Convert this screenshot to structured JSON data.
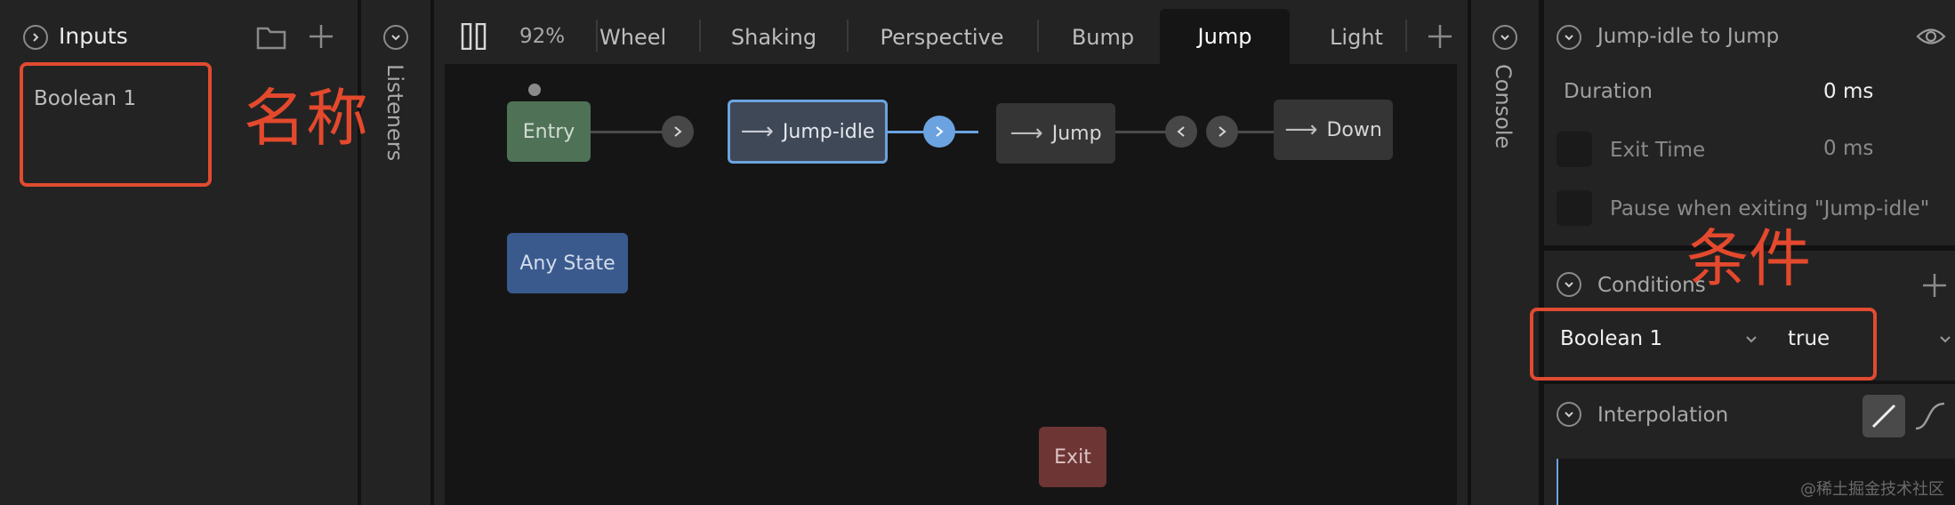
{
  "inputs_panel": {
    "title": "Inputs",
    "items": [
      {
        "label": "Boolean 1"
      }
    ]
  },
  "listeners_panel": {
    "title": "Listeners"
  },
  "console_panel": {
    "title": "Console"
  },
  "toolbar": {
    "zoom": "92%",
    "tabs": [
      {
        "label": "Wheel"
      },
      {
        "label": "Shaking"
      },
      {
        "label": "Perspective"
      },
      {
        "label": "Bump"
      },
      {
        "label": "Jump"
      },
      {
        "label": "Light"
      }
    ],
    "active_tab": "Jump"
  },
  "graph": {
    "nodes": {
      "entry": "Entry",
      "jump_idle": "Jump-idle",
      "jump": "Jump",
      "down": "Down",
      "any_state": "Any State",
      "exit": "Exit"
    }
  },
  "inspector": {
    "transition": {
      "title": "Jump-idle to Jump",
      "duration_label": "Duration",
      "duration_value": "0 ms",
      "exit_time_label": "Exit Time",
      "exit_time_value": "0 ms",
      "pause_label": "Pause when exiting \"Jump-idle\""
    },
    "conditions": {
      "title": "Conditions",
      "input": "Boolean 1",
      "value": "true"
    },
    "interpolation": {
      "title": "Interpolation"
    }
  },
  "annotations": {
    "name_label": "名称",
    "condition_label": "条件"
  },
  "watermark": "@稀土掘金技术社区",
  "colors": {
    "annotation_red": "#e14b31",
    "selected_blue": "#6ba3e0",
    "entry_green": "#4f7156",
    "any_state_blue": "#3a5a8e",
    "exit_red": "#6e3535"
  }
}
